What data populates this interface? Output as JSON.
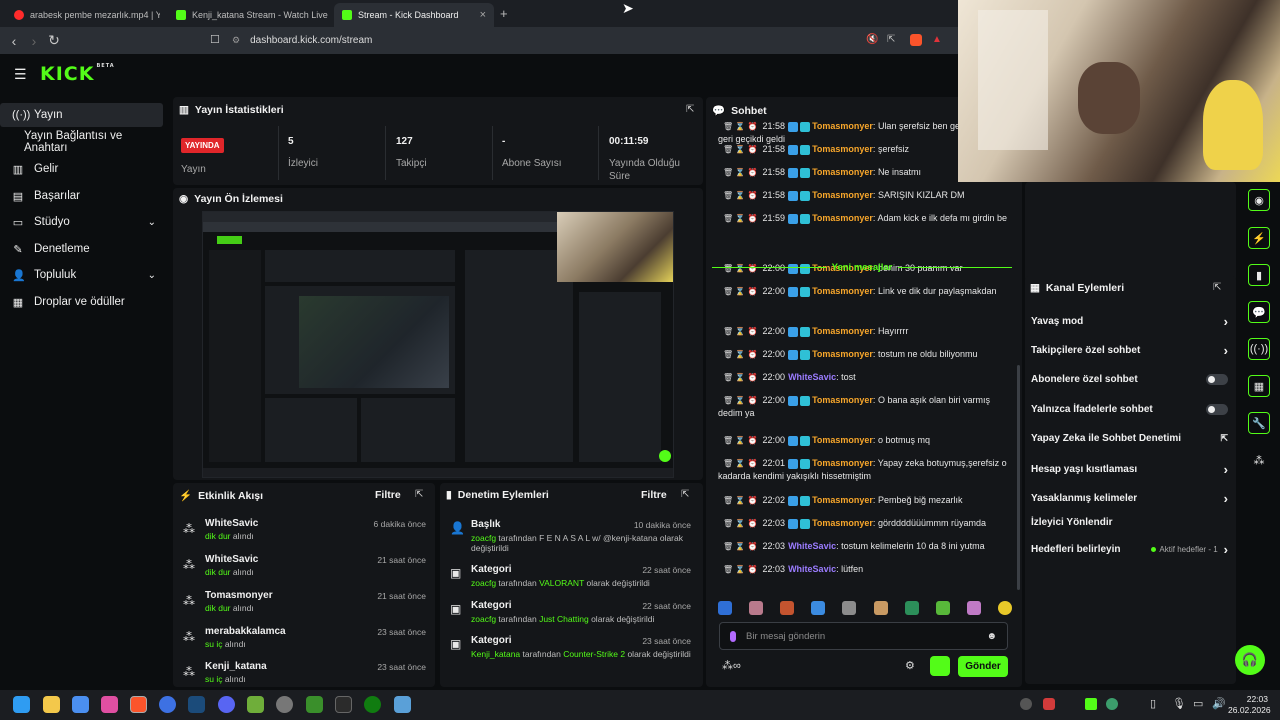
{
  "browser": {
    "tabs": [
      {
        "title": "arabesk pembe mezarlık.mp4 | Yo",
        "color": "#ff2b2b"
      },
      {
        "title": "Kenji_katana Stream - Watch Live",
        "color": "#53fc18"
      },
      {
        "title": "Stream - Kick Dashboard",
        "color": "#53fc18"
      }
    ],
    "new_tab": "+",
    "url": "dashboard.kick.com/stream"
  },
  "brand": {
    "logo": "KICK",
    "beta": "BETA",
    "accent": "#53fc18"
  },
  "sidebar": {
    "items": [
      {
        "label": "Yayın",
        "icon": "broadcast-icon"
      },
      {
        "label": "Yayın Bağlantısı ve Anahtarı"
      },
      {
        "label": "Gelir",
        "icon": "revenue-icon"
      },
      {
        "label": "Başarılar",
        "icon": "achievements-icon"
      },
      {
        "label": "Stüdyo",
        "icon": "studio-icon"
      },
      {
        "label": "Denetleme",
        "icon": "moderation-icon"
      },
      {
        "label": "Topluluk",
        "icon": "community-icon"
      },
      {
        "label": "Droplar ve ödüller",
        "icon": "drops-icon"
      }
    ]
  },
  "stats": {
    "title": "Yayın İstatistikleri",
    "live": "YAYINDA",
    "live_label": "Yayın",
    "items": [
      {
        "value": "5",
        "label": "İzleyici"
      },
      {
        "value": "127",
        "label": "Takipçi"
      },
      {
        "value": "-",
        "label": "Abone Sayısı"
      },
      {
        "value": "00:11:59",
        "label": "Yayında Olduğu Süre"
      }
    ]
  },
  "preview": {
    "title": "Yayın Ön İzlemesi"
  },
  "activity": {
    "title": "Etkinlik Akışı",
    "filter": "Filtre",
    "items": [
      {
        "name": "WhiteSavic",
        "action": "dik dur",
        "suffix": "alındı",
        "time": "6 dakika önce"
      },
      {
        "name": "WhiteSavic",
        "action": "dik dur",
        "suffix": "alındı",
        "time": "21 saat önce"
      },
      {
        "name": "Tomasmonyer",
        "action": "dik dur",
        "suffix": "alındı",
        "time": "21 saat önce"
      },
      {
        "name": "merabakkalamca",
        "action": "su iç",
        "suffix": "alındı",
        "time": "23 saat önce"
      },
      {
        "name": "Kenji_katana",
        "action": "su iç",
        "suffix": "alındı",
        "time": "23 saat önce"
      }
    ]
  },
  "moderation": {
    "title": "Denetim Eylemleri",
    "filter": "Filtre",
    "items": [
      {
        "title": "Başlık",
        "time": "10 dakika önce",
        "actor": "zoacfg",
        "mid": "tarafından F E N A S A L w/ @kenji-katana olarak değiştirildi",
        "target": ""
      },
      {
        "title": "Kategori",
        "time": "22 saat önce",
        "actor": "zoacfg",
        "mid": "tarafından",
        "target": "VALORANT",
        "end": "olarak değiştirildi"
      },
      {
        "title": "Kategori",
        "time": "22 saat önce",
        "actor": "zoacfg",
        "mid": "tarafından",
        "target": "Just Chatting",
        "end": "olarak değiştirildi"
      },
      {
        "title": "Kategori",
        "time": "23 saat önce",
        "actor": "Kenji_katana",
        "mid": "tarafından",
        "target": "Counter-Strike 2",
        "end": "olarak değiştirildi"
      }
    ]
  },
  "chat": {
    "title": "Sohbet",
    "new_messages": "Yeni mesajlar",
    "messages": [
      {
        "time": "21:58",
        "user": "Tomasmonyer",
        "text": "Ulan şerefsiz ben gelmedi,mod geri geçikdi geldi"
      },
      {
        "time": "21:58",
        "user": "Tomasmonyer",
        "text": "şerefsiz"
      },
      {
        "time": "21:58",
        "user": "Tomasmonyer",
        "text": "Ne insatmı"
      },
      {
        "time": "21:58",
        "user": "Tomasmonyer",
        "text": "SARIŞIN KIZLAR DM"
      },
      {
        "time": "21:59",
        "user": "Tomasmonyer",
        "text": "Adam kick e ilk defa mı girdin be"
      },
      {
        "time": "22:00",
        "user": "Tomasmonyer",
        "text": "benim 30 puanım var"
      },
      {
        "time": "22:00",
        "user": "Tomasmonyer",
        "text": "Link ve dik dur paylaşmakdan"
      },
      {
        "time": "22:00",
        "user": "Tomasmonyer",
        "text": "Hayırrrr"
      },
      {
        "time": "22:00",
        "user": "Tomasmonyer",
        "text": "tostum ne oldu biliyonmu"
      },
      {
        "time": "22:00",
        "user": "WhiteSavic",
        "text": "tost"
      },
      {
        "time": "22:00",
        "user": "Tomasmonyer",
        "text": "O bana aşık olan biri varmış dedim ya"
      },
      {
        "time": "22:00",
        "user": "Tomasmonyer",
        "text": "o botmuş mq"
      },
      {
        "time": "22:01",
        "user": "Tomasmonyer",
        "text": "Yapay zeka botuymuş,şerefsiz o kadarda kendimi yakışıklı hissetmiştim"
      },
      {
        "time": "22:02",
        "user": "Tomasmonyer",
        "text": "Pembeğ biğ mezarlık"
      },
      {
        "time": "22:03",
        "user": "Tomasmonyer",
        "text": "görddddüüümmm rüyamda"
      },
      {
        "time": "22:03",
        "user": "WhiteSavic",
        "text": "tostum kelimelerin 10 da 8 ini yutma"
      },
      {
        "time": "22:03",
        "user": "WhiteSavic",
        "text": "lütfen"
      }
    ],
    "placeholder": "Bir mesaj gönderin",
    "send": "Gönder"
  },
  "channel_actions": {
    "title": "Kanal Eylemleri",
    "items": [
      {
        "label": "Yavaş mod",
        "control": "chevron"
      },
      {
        "label": "Takipçilere özel sohbet",
        "control": "chevron"
      },
      {
        "label": "Abonelere özel sohbet",
        "control": "toggle"
      },
      {
        "label": "Yalnızca İfadelerle sohbet",
        "control": "toggle"
      },
      {
        "label": "Yapay Zeka ile Sohbet Denetimi",
        "control": "external"
      },
      {
        "label": "Hesap yaşı kısıtlaması",
        "control": "chevron"
      },
      {
        "label": "Yasaklanmış kelimeler",
        "control": "chevron"
      },
      {
        "label": "İzleyici Yönlendir",
        "control": "none"
      },
      {
        "label": "Hedefleri belirleyin",
        "control": "chevron",
        "extra": "Aktif hedefler - 1"
      }
    ]
  },
  "taskbar": {
    "time": "22:03",
    "date": "26.02.2026"
  }
}
